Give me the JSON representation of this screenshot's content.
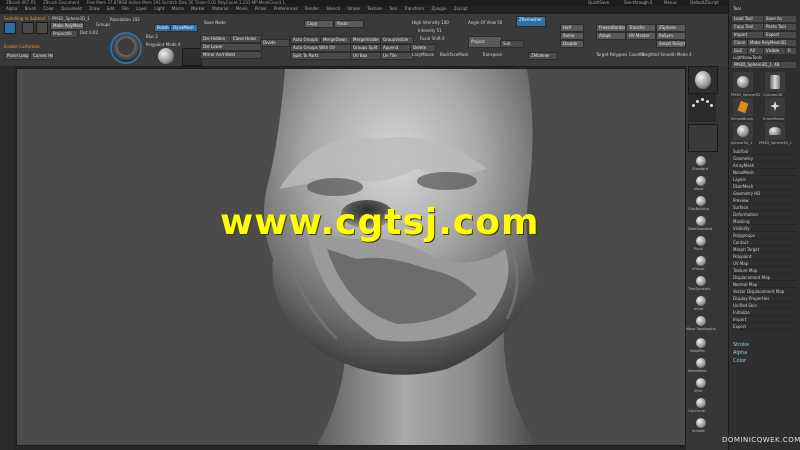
{
  "window": {
    "title_left": "ZBrush 4R7 P3",
    "title_doc": "ZBrush Document",
    "title_stats": "Free Mem 37.878GB  Active Mem 591  Scratch Disk 26  Timer 0.01  PolyCount 1.231 MP  MeshCount 1",
    "quicksave": "QuickSave",
    "see_through": "See-through  0",
    "menus": "Menus",
    "script": "DefaultZScript"
  },
  "menubar": [
    "Alpha",
    "Brush",
    "Color",
    "Document",
    "Draw",
    "Edit",
    "File",
    "Layer",
    "Light",
    "Macro",
    "Marker",
    "Material",
    "Movie",
    "Picker",
    "Preferences",
    "Render",
    "Stencil",
    "Stroke",
    "Texture",
    "Tool",
    "Transform",
    "Zplugin",
    "Zscript"
  ],
  "shelf": {
    "switching_label": "Switching to Subtool: 1",
    "subtool_name": "PM3D_Sphere3D_1",
    "make_polymesh": "Make PolyMesh3D",
    "project_all": "ProjectAll",
    "dist": "Dist 0.02",
    "groups": "Groups",
    "resolution": "Resolution 192",
    "polish": "Polish",
    "dynamesh": "DynaMesh",
    "blur": "Blur 2",
    "project": "Project",
    "polypaint_mode": "Polypaint Mode 0",
    "save_node": "Save Node",
    "sub_btn": "Sub",
    "del_hidden": "Del Hidden",
    "close_holes": "Close Holes",
    "divide": "Divide",
    "del_lower": "Del Lower",
    "mirror_and_weld": "Mirror And Weld",
    "copy": "Copy",
    "paste": "Paste",
    "auto_groups": "Auto Groups",
    "merge_down": "MergeDown",
    "merge_visible": "MergeVisible",
    "group_visible": "GroupVisible",
    "auto_groups_uv": "Auto Groups With UV",
    "groups_split": "Groups Split",
    "append": "Append",
    "split_to_parts": "Split To Parts",
    "uv_box": "UV Box",
    "uv_tile": "Uv Tile",
    "high_intensity": "High Intensity 100",
    "intensity": "Intensity 51",
    "focal_shift": "Focal Shift 0",
    "angle_of_view": "Angle Of View 50",
    "delete": "Delete",
    "zremesher": "ZRemesher",
    "half": "Half",
    "same": "Same",
    "double": "Double",
    "adapt": "Adapt",
    "freeze_border": "FreezeBorder",
    "target_polygons": "Target Polygons Count 5",
    "weighted_smooth": "Weighted Smooth Mode 4",
    "panel_loop": "Panel Loops",
    "curves_helper": "Curves Helper",
    "polish_by_features": "Polish By Features",
    "backface_mask": "BackfaceMask",
    "mask_by_cavity": "Mask By Cavity",
    "lazy_mouse": "LazyMouse",
    "transpose": "Transpose",
    "zmodeler": "ZModeler",
    "smart_resym": "Smart ReSym",
    "resym": "ReSym",
    "zsphere": "ZSphere",
    "transfer": "Transfer",
    "uv_master": "UV Master",
    "enable_customize": "Enable Customize"
  },
  "tool_tray": {
    "header": "Tool",
    "buttons": [
      "Load Tool",
      "Save As",
      "Copy Tool",
      "Paste Tool",
      "Import",
      "Export",
      "Clone",
      "Make PolyMesh3D",
      "GoZ",
      "All",
      "Visible",
      "R"
    ],
    "lightbox_tools": "Lightbox▸Tools",
    "current_tool": "PM3D_Sphere3D_1. 48",
    "thumbnails": [
      "PM3D_Sphere3D",
      "Cylinder3D",
      "SimpleBrush",
      "EraserBrush",
      "Sphere3D_1",
      "PM3D_Sphere3D_1"
    ],
    "sections": [
      "SubTool",
      "Geometry",
      "ArrayMesh",
      "NanoMesh",
      "Layers",
      "FiberMesh",
      "Geometry HD",
      "Preview",
      "Surface",
      "Deformation",
      "Masking",
      "Visibility",
      "Polygroups",
      "Contact",
      "Morph Target",
      "Polypaint",
      "UV Map",
      "Texture Map",
      "Displacement Map",
      "Normal Map",
      "Vector Displacement Map",
      "Display Properties",
      "Unified Skin",
      "Initialize",
      "Import",
      "Export"
    ],
    "subpalettes": [
      "Stroke",
      "Alpha",
      "Color"
    ]
  },
  "right_shelf": {
    "brushes": [
      "Standard",
      "Move",
      "ClayBuildup",
      "DamStandard",
      "Pinch",
      "hPolish",
      "TrimDynamic",
      "Inflat",
      "Move Topological",
      "MaskPen",
      "SelectRect",
      "Slice",
      "ClipCurve",
      "Smooth"
    ]
  },
  "watermark": "www.cgtsj.com",
  "credit": "DOMINICQWEK.COM"
}
